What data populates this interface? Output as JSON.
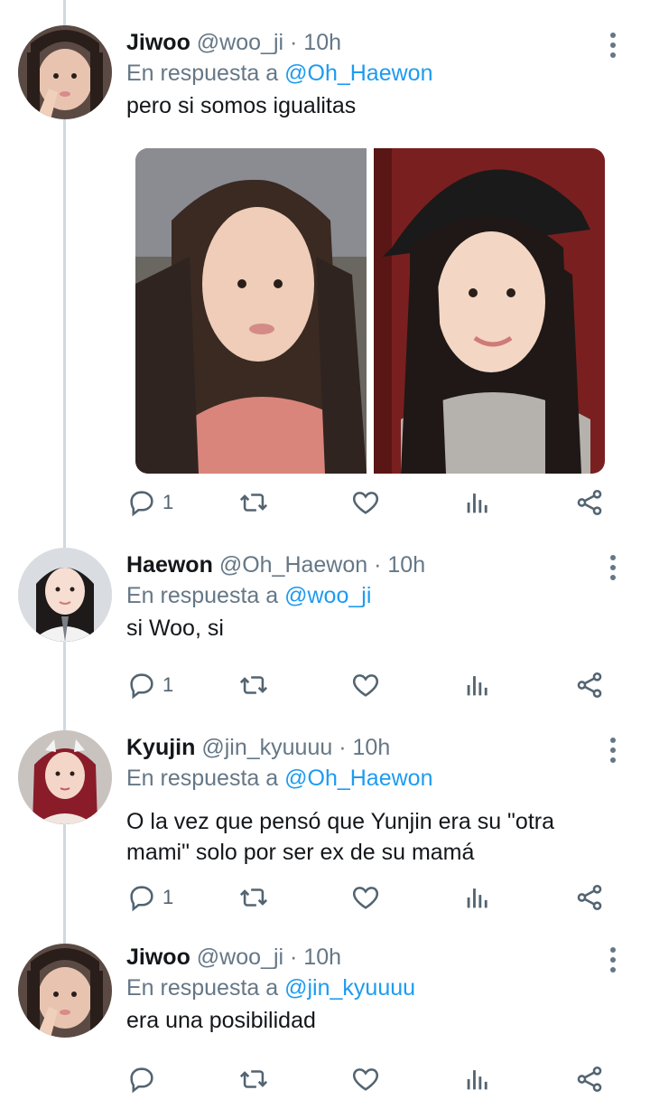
{
  "tweets": [
    {
      "name": "Jiwoo",
      "handle": "@woo_ji",
      "time": "· 10h",
      "reply_prefix": "En respuesta a",
      "reply_to": "@Oh_Haewon",
      "text": "pero si somos igualitas",
      "reply_count": "1"
    },
    {
      "name": "Haewon",
      "handle": "@Oh_Haewon",
      "time": "· 10h",
      "reply_prefix": "En respuesta a",
      "reply_to": "@woo_ji",
      "text": "si Woo, si",
      "reply_count": "1"
    },
    {
      "name": "Kyujin",
      "handle": "@jin_kyuuuu",
      "time": "· 10h",
      "reply_prefix": "En respuesta a",
      "reply_to": "@Oh_Haewon",
      "text": "O la vez que pensó que Yunjin era su \"otra mami\" solo por ser ex de su mamá",
      "reply_count": "1"
    },
    {
      "name": "Jiwoo",
      "handle": "@woo_ji",
      "time": "· 10h",
      "reply_prefix": "En respuesta a",
      "reply_to": "@jin_kyuuuu",
      "text": "era una posibilidad",
      "reply_count": ""
    }
  ],
  "icons": {
    "reply": "reply-icon",
    "retweet": "retweet-icon",
    "like": "heart-icon",
    "views": "views-icon",
    "share": "share-icon",
    "more": "more-vertical-icon"
  },
  "colors": {
    "mention": "#1d9bf0",
    "secondary_text": "#657786",
    "thread_line": "#cfd9de"
  }
}
